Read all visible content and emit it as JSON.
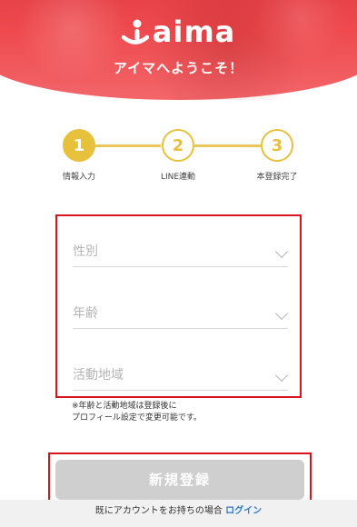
{
  "header": {
    "logo_text": "aima",
    "welcome": "アイマへようこそ！"
  },
  "stepper": {
    "steps": [
      {
        "number": "1",
        "label": "情報入力",
        "state": "active"
      },
      {
        "number": "2",
        "label": "LINE連動",
        "state": "todo"
      },
      {
        "number": "3",
        "label": "本登録完了",
        "state": "todo"
      }
    ]
  },
  "form": {
    "fields": [
      {
        "label": "性別"
      },
      {
        "label": "年齢"
      },
      {
        "label": "活動地域"
      }
    ],
    "note_line1": "※年齢と活動地域は登録後に",
    "note_line2": "プロフィール設定で変更可能です。"
  },
  "submit": {
    "label": "新規登録"
  },
  "footer": {
    "text": "既にアカウントをお持ちの場合",
    "login_link": "ログイン"
  },
  "colors": {
    "brand_red": "#ee4a4e",
    "step_yellow": "#e7c13c",
    "link_blue": "#2f79c2",
    "highlight_red": "#d8131d"
  }
}
